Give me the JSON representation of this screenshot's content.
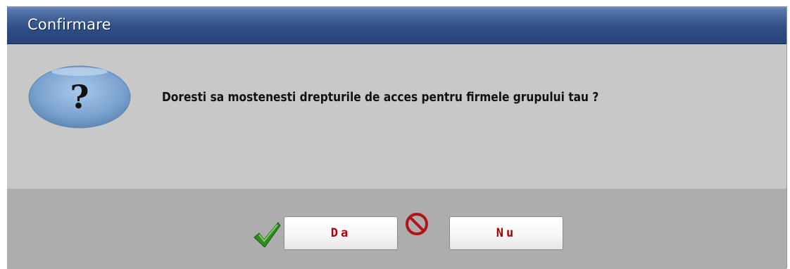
{
  "dialog": {
    "title": "Confirmare",
    "message": "Doresti sa mostenesti drepturile de acces pentru firmele grupului tau ?",
    "icon": "question-icon",
    "icon_glyph": "?"
  },
  "buttons": {
    "yes": {
      "label": "Da",
      "icon": "checkmark-icon"
    },
    "no": {
      "label": "Nu",
      "icon": "no-entry-icon"
    }
  },
  "colors": {
    "title_bar": "#2f4d86",
    "dialog_background": "#c8c8c8",
    "button_bar": "#adadad",
    "button_text": "#b00000",
    "check_green": "#2e8b1e",
    "no_red": "#b01515",
    "question_bubble": "#7ba3cf"
  }
}
